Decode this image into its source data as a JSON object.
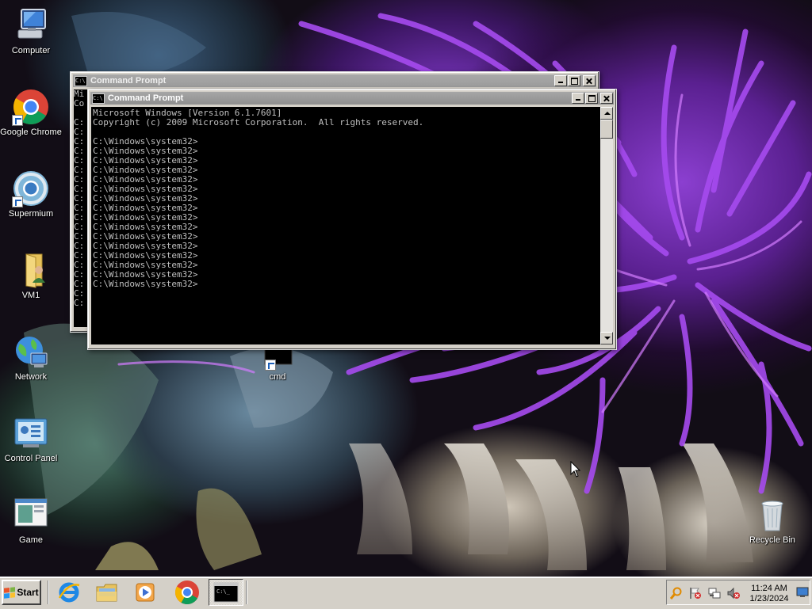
{
  "desktop": {
    "icons": [
      {
        "label": "Computer",
        "icon": "computer-icon"
      },
      {
        "label": "Google Chrome",
        "icon": "chrome-icon"
      },
      {
        "label": "Supermium",
        "icon": "supermium-icon"
      },
      {
        "label": "VM1",
        "icon": "folder-icon"
      },
      {
        "label": "Network",
        "icon": "network-icon"
      },
      {
        "label": "Control Panel",
        "icon": "control-panel-icon"
      },
      {
        "label": "Game",
        "icon": "game-icon"
      },
      {
        "label": "cmd",
        "icon": "cmd-icon"
      },
      {
        "label": "Recycle Bin",
        "icon": "recycle-bin-icon"
      }
    ]
  },
  "windows": [
    {
      "title": "Command Prompt",
      "active": false,
      "visible_text": [
        "Mi",
        "Co",
        "",
        "C:",
        "C:",
        "C:",
        "C:",
        "C:",
        "C:",
        "C:",
        "C:",
        "C:",
        "C:",
        "C:",
        "C:",
        "C:",
        "C:",
        "C:",
        "C:",
        "C:",
        "C:",
        "C:",
        "C:"
      ]
    },
    {
      "title": "Command Prompt",
      "active": true,
      "lines": [
        "Microsoft Windows [Version 6.1.7601]",
        "Copyright (c) 2009 Microsoft Corporation.  All rights reserved.",
        "",
        "C:\\Windows\\system32>",
        "C:\\Windows\\system32>",
        "C:\\Windows\\system32>",
        "C:\\Windows\\system32>",
        "C:\\Windows\\system32>",
        "C:\\Windows\\system32>",
        "C:\\Windows\\system32>",
        "C:\\Windows\\system32>",
        "C:\\Windows\\system32>",
        "C:\\Windows\\system32>",
        "C:\\Windows\\system32>",
        "C:\\Windows\\system32>",
        "C:\\Windows\\system32>",
        "C:\\Windows\\system32>",
        "C:\\Windows\\system32>",
        "C:\\Windows\\system32>"
      ]
    }
  ],
  "taskbar": {
    "start_label": "Start",
    "pinned": [
      {
        "name": "internet-explorer-icon"
      },
      {
        "name": "explorer-folder-icon"
      },
      {
        "name": "media-player-icon"
      },
      {
        "name": "chrome-taskbar-icon"
      },
      {
        "name": "cmd-taskbar-icon",
        "pressed": true
      }
    ],
    "tray": {
      "icons": [
        "search-tray-icon",
        "flag-tray-icon",
        "network-tray-icon",
        "volume-muted-icon"
      ],
      "time": "11:24 AM",
      "date": "1/23/2024",
      "show_desktop": "monitor-icon"
    }
  }
}
